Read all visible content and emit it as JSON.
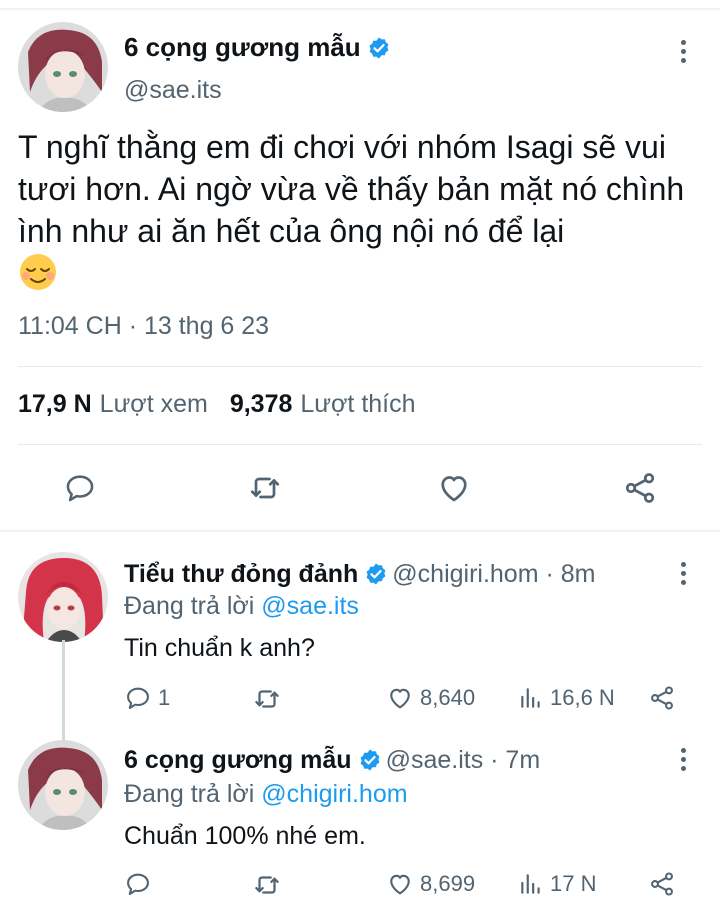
{
  "main_tweet": {
    "author_name": "6 cọng gương mẫu",
    "handle": "@sae.its",
    "text": "T nghĩ thằng em đi chơi với nhóm Isagi sẽ vui tươi hơn. Ai ngờ vừa về thấy bản mặt nó chình ình như ai ăn hết của ông nội nó để lại",
    "emoji": "relieved-face-emoji",
    "timestamp": "11:04 CH · 13 thg 6 23",
    "views_count": "17,9 N",
    "views_label": "Lượt xem",
    "likes_count": "9,378",
    "likes_label": "Lượt thích"
  },
  "replies": [
    {
      "author_name": "Tiểu thư đỏng đảnh",
      "meta": "@chigiri.hom · 8m",
      "replying_prefix": "Đang trả lời",
      "replying_to": "@sae.its",
      "text": "Tin chuẩn k anh?",
      "reply_count": "1",
      "like_count": "8,640",
      "view_count": "16,6 N"
    },
    {
      "author_name": "6 cọng gương mẫu",
      "meta": "@sae.its · 7m",
      "replying_prefix": "Đang trả lời",
      "replying_to": "@chigiri.hom",
      "text": "Chuẩn 100% nhé em.",
      "reply_count": "",
      "like_count": "8,699",
      "view_count": "17 N"
    }
  ],
  "colors": {
    "verified": "#1d9bf0",
    "link": "#1d9bf0",
    "muted": "#536471",
    "text": "#0f1419"
  }
}
